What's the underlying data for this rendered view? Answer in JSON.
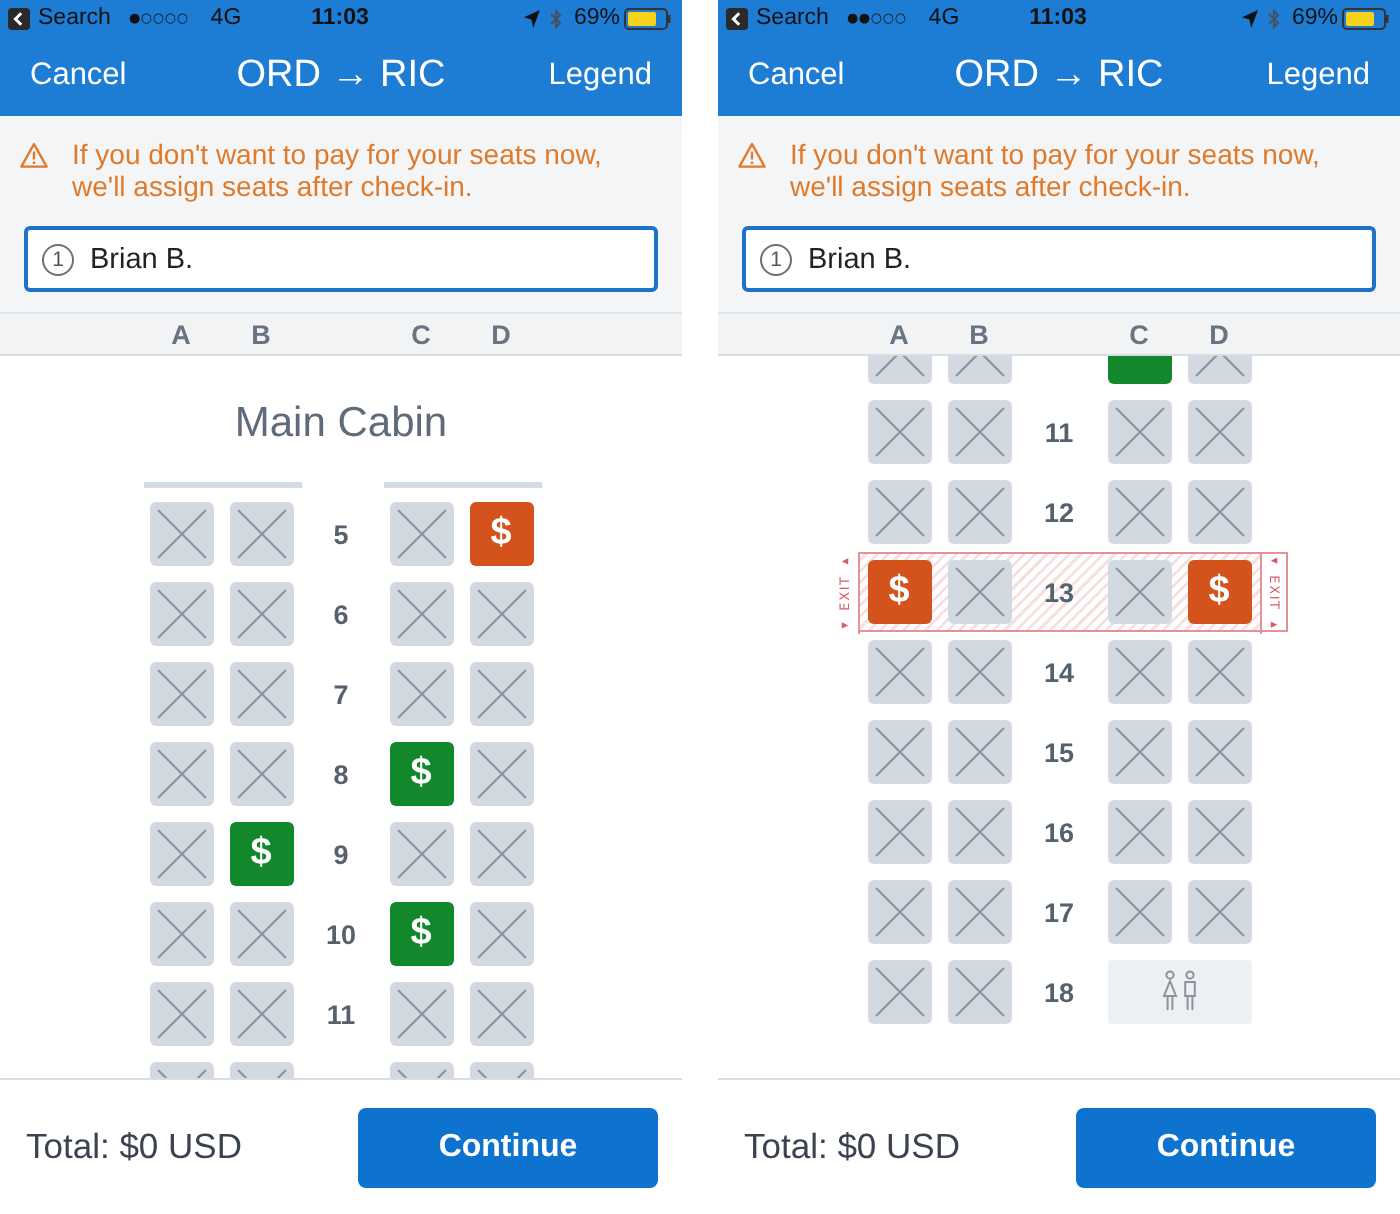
{
  "screens": [
    {
      "status_bar": {
        "back_app": "Search",
        "signal": "●○○○○",
        "network": "4G",
        "time": "11:03",
        "battery": "69%"
      },
      "nav_bar": {
        "cancel": "Cancel",
        "title": "ORD → RIC",
        "legend": "Legend"
      },
      "notice": "If you don't want to pay for your seats now, we'll assign seats after check-in.",
      "passenger": {
        "number": "1",
        "name": "Brian B.",
        "selected": true
      },
      "columns": [
        "A",
        "B",
        "C",
        "D"
      ],
      "cabin_title": "Main Cabin",
      "rows": [
        {
          "number": "5",
          "partial": false,
          "exit": false,
          "seats": [
            {
              "kind": "taken"
            },
            {
              "kind": "taken"
            },
            {
              "kind": "taken"
            },
            {
              "kind": "paid",
              "label": "$",
              "color": "#d4531c"
            }
          ]
        },
        {
          "number": "6",
          "partial": false,
          "exit": false,
          "seats": [
            {
              "kind": "taken"
            },
            {
              "kind": "taken"
            },
            {
              "kind": "taken"
            },
            {
              "kind": "taken"
            }
          ]
        },
        {
          "number": "7",
          "partial": false,
          "exit": false,
          "seats": [
            {
              "kind": "taken"
            },
            {
              "kind": "taken"
            },
            {
              "kind": "taken"
            },
            {
              "kind": "taken"
            }
          ]
        },
        {
          "number": "8",
          "partial": false,
          "exit": false,
          "seats": [
            {
              "kind": "taken"
            },
            {
              "kind": "taken"
            },
            {
              "kind": "paid",
              "label": "$",
              "color": "#13872c"
            },
            {
              "kind": "taken"
            }
          ]
        },
        {
          "number": "9",
          "partial": false,
          "exit": false,
          "seats": [
            {
              "kind": "taken"
            },
            {
              "kind": "paid",
              "label": "$",
              "color": "#13872c"
            },
            {
              "kind": "taken"
            },
            {
              "kind": "taken"
            }
          ]
        },
        {
          "number": "10",
          "partial": false,
          "exit": false,
          "seats": [
            {
              "kind": "taken"
            },
            {
              "kind": "taken"
            },
            {
              "kind": "paid",
              "label": "$",
              "color": "#13872c"
            },
            {
              "kind": "taken"
            }
          ]
        },
        {
          "number": "11",
          "partial": false,
          "exit": false,
          "seats": [
            {
              "kind": "taken"
            },
            {
              "kind": "taken"
            },
            {
              "kind": "taken"
            },
            {
              "kind": "taken"
            }
          ]
        },
        {
          "partial": true,
          "exit": false,
          "seats": [
            {
              "kind": "taken"
            },
            {
              "kind": "taken"
            },
            {
              "kind": "taken"
            },
            {
              "kind": "taken"
            }
          ]
        }
      ],
      "footer": {
        "total": "Total: $0 USD",
        "button": "Continue"
      }
    },
    {
      "status_bar": {
        "back_app": "Search",
        "signal": "●●○○○",
        "network": "4G",
        "time": "11:03",
        "battery": "69%"
      },
      "nav_bar": {
        "cancel": "Cancel",
        "title": "ORD → RIC",
        "legend": "Legend"
      },
      "notice": "If you don't want to pay for your seats now, we'll assign seats after check-in.",
      "passenger": {
        "number": "1",
        "name": "Brian B.",
        "selected": true
      },
      "columns": [
        "A",
        "B",
        "C",
        "D"
      ],
      "rows": [
        {
          "partial": true,
          "exit": false,
          "seats": [
            {
              "kind": "taken"
            },
            {
              "kind": "taken"
            },
            {
              "kind": "paid",
              "color": "#13872c"
            },
            {
              "kind": "taken"
            }
          ]
        },
        {
          "number": "11",
          "partial": false,
          "exit": false,
          "seats": [
            {
              "kind": "taken"
            },
            {
              "kind": "taken"
            },
            {
              "kind": "taken"
            },
            {
              "kind": "taken"
            }
          ]
        },
        {
          "number": "12",
          "partial": false,
          "exit": false,
          "seats": [
            {
              "kind": "taken"
            },
            {
              "kind": "taken"
            },
            {
              "kind": "taken"
            },
            {
              "kind": "taken"
            }
          ]
        },
        {
          "number": "13",
          "partial": false,
          "exit": true,
          "exit_labels": [
            "◂ EXIT ▸",
            "◂ EXIT ▸"
          ],
          "seats": [
            {
              "kind": "paid",
              "label": "$",
              "color": "#d4531c"
            },
            {
              "kind": "taken"
            },
            {
              "kind": "taken"
            },
            {
              "kind": "paid",
              "label": "$",
              "color": "#d4531c"
            }
          ]
        },
        {
          "number": "14",
          "partial": false,
          "exit": false,
          "seats": [
            {
              "kind": "taken"
            },
            {
              "kind": "taken"
            },
            {
              "kind": "taken"
            },
            {
              "kind": "taken"
            }
          ]
        },
        {
          "number": "15",
          "partial": false,
          "exit": false,
          "seats": [
            {
              "kind": "taken"
            },
            {
              "kind": "taken"
            },
            {
              "kind": "taken"
            },
            {
              "kind": "taken"
            }
          ]
        },
        {
          "number": "16",
          "partial": false,
          "exit": false,
          "seats": [
            {
              "kind": "taken"
            },
            {
              "kind": "taken"
            },
            {
              "kind": "taken"
            },
            {
              "kind": "taken"
            }
          ]
        },
        {
          "number": "17",
          "partial": false,
          "exit": false,
          "seats": [
            {
              "kind": "taken"
            },
            {
              "kind": "taken"
            },
            {
              "kind": "taken"
            },
            {
              "kind": "taken"
            }
          ]
        },
        {
          "number": "18",
          "partial": false,
          "exit": false,
          "seats": [
            {
              "kind": "taken"
            },
            {
              "kind": "taken"
            },
            {
              "kind": "lavatory"
            }
          ]
        }
      ],
      "footer": {
        "total": "Total: $0 USD",
        "button": "Continue"
      }
    }
  ]
}
